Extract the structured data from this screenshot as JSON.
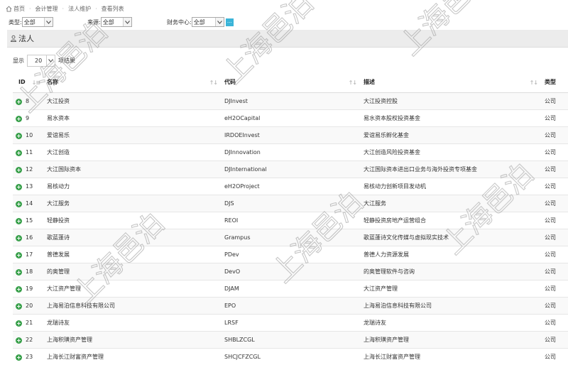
{
  "breadcrumb": [
    "首页",
    "会计管理",
    "法人维护",
    "查看列表"
  ],
  "filters": {
    "type": {
      "label": "类型:",
      "value": "全部"
    },
    "source": {
      "label": "来源:",
      "value": "全部"
    },
    "finance_center": {
      "label": "财务中心:",
      "value": "全部",
      "button": "..."
    }
  },
  "panel": {
    "title": "法人"
  },
  "length": {
    "prefix": "显示",
    "value": "20",
    "suffix": "项结果"
  },
  "table": {
    "headers": [
      "ID",
      "名称",
      "代码",
      "描述",
      "类型"
    ],
    "rows": [
      [
        "8",
        "大江投资",
        "DJInvest",
        "大江投资控股",
        "公司"
      ],
      [
        "9",
        "易水资本",
        "eH2OCapital",
        "易水资本股权投资基金",
        "公司"
      ],
      [
        "10",
        "爱谊易乐",
        "IRDOEInvest",
        "爱谊易乐孵化基金",
        "公司"
      ],
      [
        "11",
        "大江创造",
        "DJInnovation",
        "大江创造风险投资基金",
        "公司"
      ],
      [
        "12",
        "大江国际资本",
        "DJInternational",
        "大江国际资本进出口业务与海外投资专项基金",
        "公司"
      ],
      [
        "13",
        "易核动力",
        "eH2OProject",
        "易核动力创新项目发动机",
        "公司"
      ],
      [
        "14",
        "大江服务",
        "DJS",
        "大江服务",
        "公司"
      ],
      [
        "15",
        "轻静投资",
        "REOI",
        "轻静投资房地产运营组合",
        "公司"
      ],
      [
        "16",
        "歌蓝蓬诗",
        "Grampus",
        "歌蓝蓬诗文化传媒与虚拟现实技术",
        "公司"
      ],
      [
        "17",
        "普德发展",
        "PDev",
        "普德人力资源发展",
        "公司"
      ],
      [
        "18",
        "的奥管理",
        "DevO",
        "的奥管理软件与咨询",
        "公司"
      ],
      [
        "19",
        "大江资产管理",
        "DJAM",
        "大江资产管理",
        "公司"
      ],
      [
        "20",
        "上海易泊信息科技有限公司",
        "EPO",
        "上海易泊信息科技有限公司",
        "公司"
      ],
      [
        "21",
        "龙瑞诗友",
        "LRSF",
        "龙瑞诗友",
        "公司"
      ],
      [
        "22",
        "上海积璜资产管理",
        "SHBLZCGL",
        "上海积璜资产管理",
        "公司"
      ],
      [
        "23",
        "上海长江财富资产管理",
        "SHCJCFZCGL",
        "上海长江财富资产管理",
        "公司"
      ]
    ]
  },
  "watermark": "上海邑泊",
  "colors": {
    "accent": "#3bb4d8",
    "expand": "#39a04b",
    "panel": "#ececec"
  },
  "icons": {
    "home": "home-icon",
    "panel": "user-icon",
    "expand": "plus-circle-icon",
    "sort": "sort-icon"
  }
}
